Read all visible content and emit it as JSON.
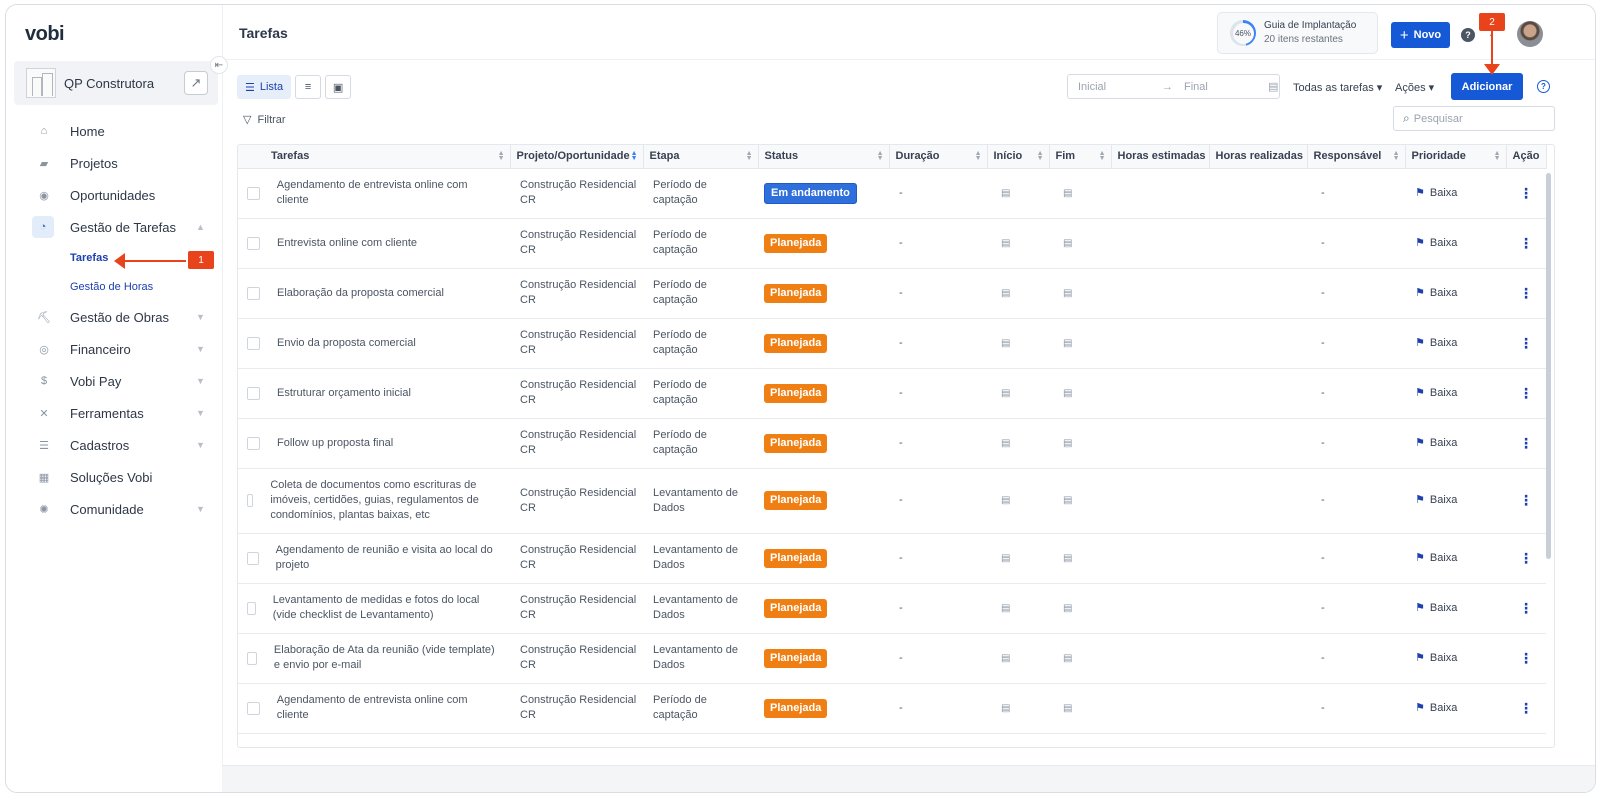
{
  "app": {
    "logo": "vobi"
  },
  "company": {
    "name": "QP Construtora"
  },
  "sidebar": {
    "items": [
      {
        "label": "Home",
        "icon": "home-icon",
        "glyph": "⌂"
      },
      {
        "label": "Projetos",
        "icon": "folder-icon",
        "glyph": "▰"
      },
      {
        "label": "Oportunidades",
        "icon": "handshake-icon",
        "glyph": "◉"
      },
      {
        "label": "Gestão de Tarefas",
        "icon": "tasks-icon",
        "glyph": "◔"
      },
      {
        "label": "Gestão de Obras",
        "icon": "construction-icon",
        "glyph": "⛏"
      },
      {
        "label": "Financeiro",
        "icon": "coins-icon",
        "glyph": "◎"
      },
      {
        "label": "Vobi Pay",
        "icon": "dollar-circle-icon",
        "glyph": "$"
      },
      {
        "label": "Ferramentas",
        "icon": "tools-icon",
        "glyph": "✕"
      },
      {
        "label": "Cadastros",
        "icon": "list-icon",
        "glyph": "☰"
      },
      {
        "label": "Soluções Vobi",
        "icon": "apps-icon",
        "glyph": "▦"
      },
      {
        "label": "Comunidade",
        "icon": "community-icon",
        "glyph": "✺"
      }
    ],
    "subitems": {
      "tarefas": "Tarefas",
      "horas": "Gestão de Horas"
    }
  },
  "header": {
    "title": "Tarefas"
  },
  "guide": {
    "percent": "46%",
    "title": "Guia de Implantação",
    "remaining": "20 itens restantes"
  },
  "actions": {
    "novo": "Novo",
    "adicionar": "Adicionar",
    "help": "?"
  },
  "views": {
    "lista": "Lista"
  },
  "filters": {
    "label": "Filtrar",
    "date_start": "Inicial",
    "date_end": "Final",
    "all_tasks": "Todas as tarefas",
    "acoes": "Ações",
    "search_placeholder": "Pesquisar"
  },
  "table": {
    "headers": [
      "Tarefas",
      "Projeto/Oportunidade",
      "Etapa",
      "Status",
      "Duração",
      "Início",
      "Fim",
      "Horas estimadas",
      "Horas realizadas",
      "Responsável",
      "Prioridade",
      "Ação"
    ],
    "rows": [
      {
        "task": "Agendamento de entrevista online com cliente",
        "project": "Construção Residencial CR",
        "stage": "Período de captação",
        "status": "Em andamento",
        "duration": "-",
        "responsible": "-",
        "priority": "Baixa"
      },
      {
        "task": "Entrevista online com cliente",
        "project": "Construção Residencial CR",
        "stage": "Período de captação",
        "status": "Planejada",
        "duration": "-",
        "responsible": "-",
        "priority": "Baixa"
      },
      {
        "task": "Elaboração da proposta comercial",
        "project": "Construção Residencial CR",
        "stage": "Período de captação",
        "status": "Planejada",
        "duration": "-",
        "responsible": "-",
        "priority": "Baixa"
      },
      {
        "task": "Envio da proposta comercial",
        "project": "Construção Residencial CR",
        "stage": "Período de captação",
        "status": "Planejada",
        "duration": "-",
        "responsible": "-",
        "priority": "Baixa"
      },
      {
        "task": "Estruturar orçamento inicial",
        "project": "Construção Residencial CR",
        "stage": "Período de captação",
        "status": "Planejada",
        "duration": "-",
        "responsible": "-",
        "priority": "Baixa"
      },
      {
        "task": "Follow up proposta final",
        "project": "Construção Residencial CR",
        "stage": "Período de captação",
        "status": "Planejada",
        "duration": "-",
        "responsible": "-",
        "priority": "Baixa"
      },
      {
        "task": "Coleta de documentos como escrituras de imóveis, certidões, guias, regulamentos de condomínios, plantas baixas, etc",
        "project": "Construção Residencial CR",
        "stage": "Levantamento de Dados",
        "status": "Planejada",
        "duration": "-",
        "responsible": "-",
        "priority": "Baixa"
      },
      {
        "task": "Agendamento de reunião e visita ao local do projeto",
        "project": "Construção Residencial CR",
        "stage": "Levantamento de Dados",
        "status": "Planejada",
        "duration": "-",
        "responsible": "-",
        "priority": "Baixa"
      },
      {
        "task": "Levantamento de medidas e fotos do local (vide checklist de Levantamento)",
        "project": "Construção Residencial CR",
        "stage": "Levantamento de Dados",
        "status": "Planejada",
        "duration": "-",
        "responsible": "-",
        "priority": "Baixa"
      },
      {
        "task": "Elaboração de Ata da reunião (vide template) e envio por e-mail",
        "project": "Construção Residencial CR",
        "stage": "Levantamento de Dados",
        "status": "Planejada",
        "duration": "-",
        "responsible": "-",
        "priority": "Baixa"
      },
      {
        "task": "Agendamento de entrevista online com cliente",
        "project": "Construção Residencial CR",
        "stage": "Período de captação",
        "status": "Planejada",
        "duration": "-",
        "responsible": "-",
        "priority": "Baixa"
      }
    ]
  },
  "annotations": {
    "a1": "1",
    "a2": "2"
  },
  "colors": {
    "primary": "#1659d6",
    "in_progress": "#2f6fdb",
    "planned": "#f07f13",
    "annotation": "#e8431b"
  }
}
